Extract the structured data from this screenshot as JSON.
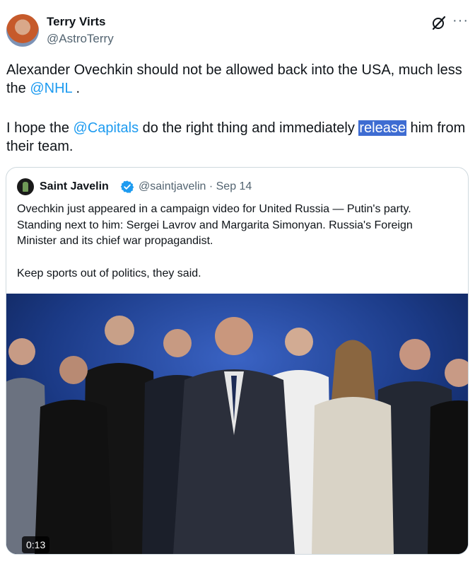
{
  "author": {
    "name": "Terry Virts",
    "handle": "@AstroTerry"
  },
  "tweet": {
    "line1": "Alexander Ovechkin should not be allowed back into the USA, much less",
    "line2_prefix": "the ",
    "mention_nhl": "@NHL",
    "line2_suffix": " .",
    "line3_prefix": "I hope the ",
    "mention_capitals": "@Capitals",
    "line3_middle": " do the right thing and immediately ",
    "highlighted_word": "release",
    "line3_suffix": " him from",
    "line4": "their team."
  },
  "quoted": {
    "name": "Saint Javelin",
    "meta": "@saintjavelin · Sep 14",
    "text_line1": "Ovechkin just appeared in a campaign video for United Russia — Putin's party.",
    "text_line2": "Standing next to him: Sergei Lavrov and Margarita Simonyan. Russia's Foreign",
    "text_line3": "Minister and its chief war propagandist.",
    "text_line4": "Keep sports out of politics, they said.",
    "video_duration": "0:13"
  },
  "icons": {
    "grok": "grok-icon",
    "more": "more-icon",
    "verified": "verified-badge-icon"
  },
  "colors": {
    "link": "#1d9bf0",
    "highlight": "#3e6cd2",
    "verified": "#1d9bf0",
    "video_bg": "#0c1e4a"
  }
}
